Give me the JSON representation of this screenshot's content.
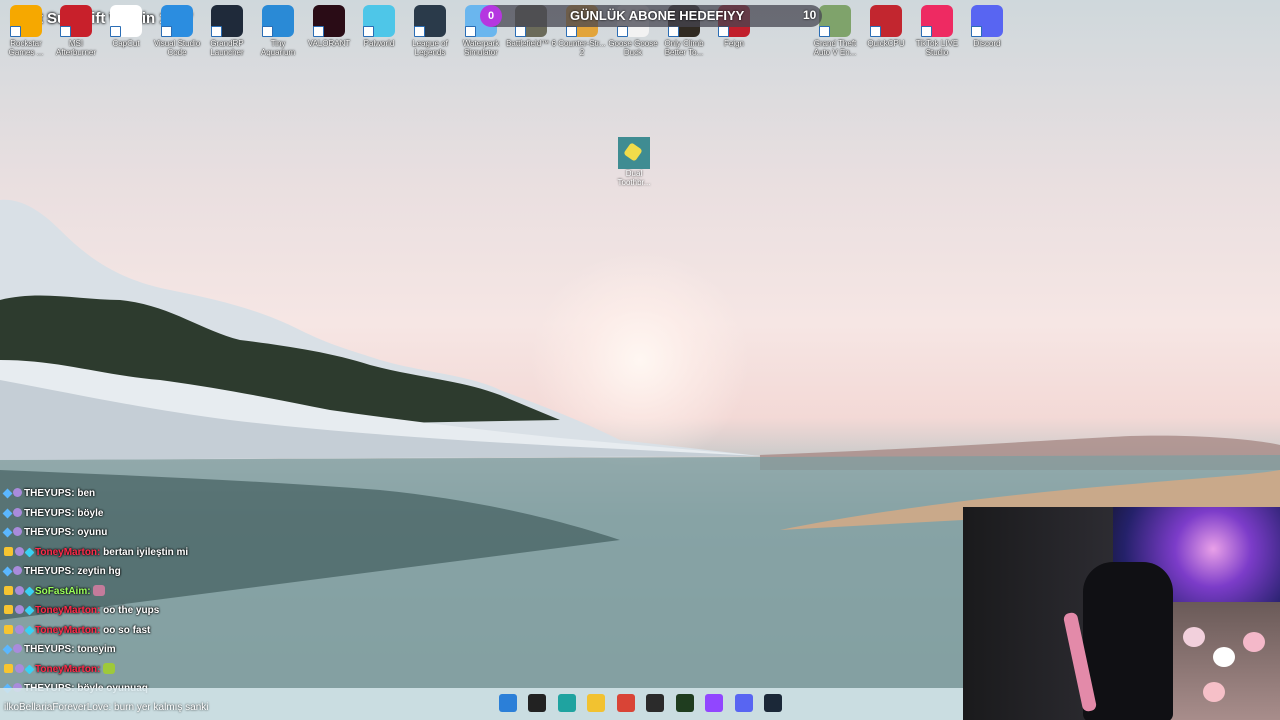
{
  "overlay": {
    "sub_goal_text": "Fast Sub Gift Within 1907",
    "goal": {
      "current": "0",
      "title": "GÜNLÜK ABONE HEDEFIYY",
      "target": "10"
    }
  },
  "desktop_icons": [
    {
      "label": "Rockstar Games ...",
      "color": "#f6a800"
    },
    {
      "label": "MSI Afterburner",
      "color": "#c8202b"
    },
    {
      "label": "CapCut",
      "color": "#ffffff"
    },
    {
      "label": "Visual Studio Code",
      "color": "#2b8de0"
    },
    {
      "label": "GrandRP Launcher",
      "color": "#1f2a3a"
    },
    {
      "label": "Tiny Aquarium",
      "color": "#2a8ad6"
    },
    {
      "label": "VALORANT",
      "color": "#2a0c16"
    },
    {
      "label": "Palworld",
      "color": "#4ec6e8"
    },
    {
      "label": "League of Legends",
      "color": "#2a3a4a"
    },
    {
      "label": "Waterpark Simulator",
      "color": "#6ab6ee"
    },
    {
      "label": "Battlefield™ 6",
      "color": "#6b6b5a"
    },
    {
      "label": "Counter-Str... 2",
      "color": "#e2a43a"
    },
    {
      "label": "Goose Goose Duck",
      "color": "#f2f2f2"
    },
    {
      "label": "Only Climb Better To...",
      "color": "#302a22"
    },
    {
      "label": "Feign",
      "color": "#c11f2c"
    },
    {
      "label": "Grand Theft Auto V En...",
      "color": "#7fa36b"
    },
    {
      "label": "QuickCPU",
      "color": "#c2262f"
    },
    {
      "label": "TikTok LIVE Studio",
      "color": "#ee2a62"
    },
    {
      "label": "Discord",
      "color": "#5865f2"
    }
  ],
  "center_icon": {
    "label": "Dual Toothbr..."
  },
  "chat": [
    {
      "user": "THEYUPS",
      "color": "#ffffff",
      "badges": [
        "sword",
        "lav"
      ],
      "text": "ben"
    },
    {
      "user": "THEYUPS",
      "color": "#ffffff",
      "badges": [
        "sword",
        "lav"
      ],
      "text": "böyle"
    },
    {
      "user": "THEYUPS",
      "color": "#ffffff",
      "badges": [
        "sword",
        "lav"
      ],
      "text": "oyunu"
    },
    {
      "user": "ToneyMarton",
      "color": "#ff2a4a",
      "badges": [
        "crown",
        "lav",
        "gem"
      ],
      "text": "bertan iyileştin mi"
    },
    {
      "user": "THEYUPS",
      "color": "#ffffff",
      "badges": [
        "sword",
        "lav"
      ],
      "text": "zeytin hg"
    },
    {
      "user": "SoFastAim",
      "color": "#9aff5a",
      "badges": [
        "crown",
        "lav",
        "gem"
      ],
      "text": "",
      "emote": "#c47b9b"
    },
    {
      "user": "ToneyMarton",
      "color": "#ff2a4a",
      "badges": [
        "crown",
        "lav",
        "gem"
      ],
      "text": "oo the yups"
    },
    {
      "user": "ToneyMarton",
      "color": "#ff2a4a",
      "badges": [
        "crown",
        "lav",
        "gem"
      ],
      "text": "oo so fast"
    },
    {
      "user": "THEYUPS",
      "color": "#ffffff",
      "badges": [
        "sword",
        "lav"
      ],
      "text": "toneyim"
    },
    {
      "user": "ToneyMarton",
      "color": "#ff2a4a",
      "badges": [
        "crown",
        "lav",
        "gem"
      ],
      "text": "",
      "emote": "#9ec93a"
    },
    {
      "user": "THEYUPS",
      "color": "#ffffff",
      "badges": [
        "sword",
        "lav"
      ],
      "text": "böyle oyunuaq"
    }
  ],
  "bottom_note": "ilkoBellariaForeverLove: burn yer kalmış sanki",
  "taskbar_icons": [
    {
      "name": "windows-start-icon",
      "color": "#2b7fd8"
    },
    {
      "name": "task-view-icon",
      "color": "#222222"
    },
    {
      "name": "edge-icon",
      "color": "#1fa3a0"
    },
    {
      "name": "file-explorer-icon",
      "color": "#f2c230"
    },
    {
      "name": "chrome-icon",
      "color": "#d94436"
    },
    {
      "name": "obs-icon",
      "color": "#2b2b2b"
    },
    {
      "name": "terminal-icon",
      "color": "#1f3d1f"
    },
    {
      "name": "twitch-icon",
      "color": "#9146ff"
    },
    {
      "name": "discord-icon",
      "color": "#5865f2"
    },
    {
      "name": "steam-icon",
      "color": "#1b2838"
    }
  ]
}
